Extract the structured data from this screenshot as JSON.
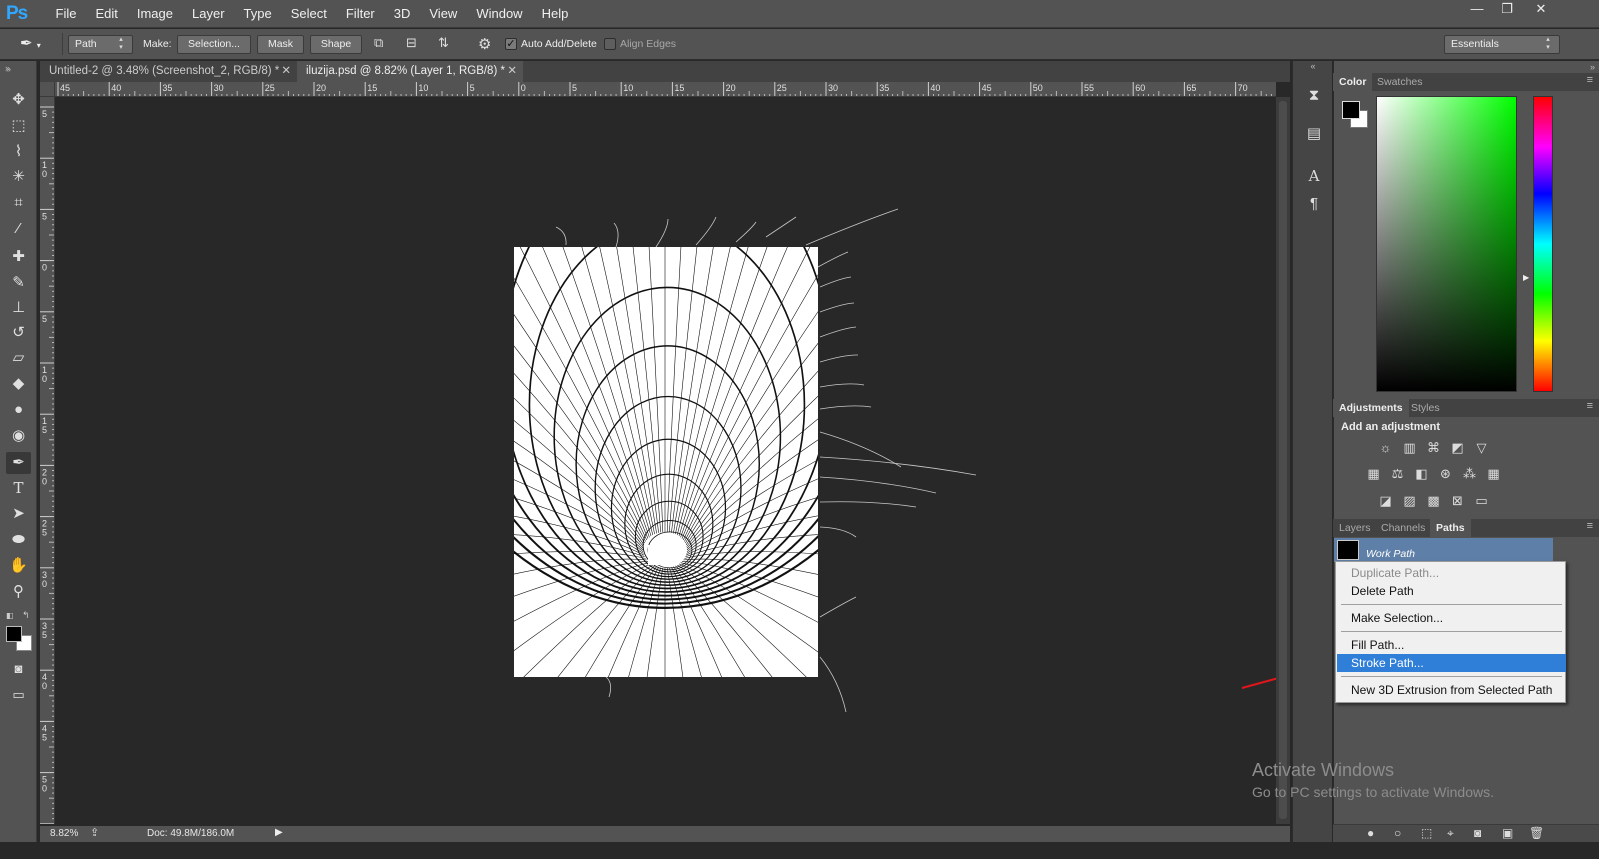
{
  "app": {
    "logo": "Ps"
  },
  "menu": [
    "File",
    "Edit",
    "Image",
    "Layer",
    "Type",
    "Select",
    "Filter",
    "3D",
    "View",
    "Window",
    "Help"
  ],
  "window_controls": {
    "minimize": "—",
    "restore": "❐",
    "close": "✕"
  },
  "options": {
    "mode": "Path",
    "make_label": "Make:",
    "selection_button": "Selection...",
    "mask_button": "Mask",
    "shape_button": "Shape",
    "auto_add_delete": "Auto Add/Delete",
    "auto_add_delete_checked": true,
    "align_edges": "Align Edges",
    "align_edges_checked": false,
    "workspace": "Essentials"
  },
  "tabs": [
    {
      "title": "Untitled-2 @ 3.48% (Screenshot_2, RGB/8) *",
      "active": false
    },
    {
      "title": "iluzija.psd @ 8.82% (Layer 1, RGB/8) *",
      "active": true
    }
  ],
  "ruler_top": [
    "45",
    "40",
    "35",
    "30",
    "25",
    "20",
    "15",
    "10",
    "5",
    "0",
    "5",
    "10",
    "15",
    "20",
    "25",
    "30",
    "35",
    "40",
    "45",
    "50",
    "55",
    "60",
    "65",
    "70"
  ],
  "ruler_left": [
    "5",
    "1 0",
    "5",
    "0",
    "5",
    "1 0",
    "1 5",
    "2 0",
    "2 5",
    "3 0",
    "3 5",
    "4 0",
    "4 5",
    "5 0",
    "5"
  ],
  "status": {
    "zoom": "8.82%",
    "doc": "Doc: 49.8M/186.0M"
  },
  "tools": [
    "move-icon",
    "marquee-icon",
    "lasso-icon",
    "magic-wand-icon",
    "crop-icon",
    "eyedropper-icon",
    "healing-brush-icon",
    "brush-icon",
    "clone-stamp-icon",
    "history-brush-icon",
    "eraser-icon",
    "paint-bucket-icon",
    "blur-icon",
    "dodge-icon",
    "pen-icon",
    "type-icon",
    "path-selection-icon",
    "ellipse-icon",
    "hand-icon",
    "zoom-icon"
  ],
  "color_panel": {
    "tabs": [
      "Color",
      "Swatches"
    ],
    "foreground": "#000000",
    "background": "#ffffff",
    "hue": "#00ff00"
  },
  "adjustments_panel": {
    "tabs": [
      "Adjustments",
      "Styles"
    ],
    "title": "Add an adjustment"
  },
  "layers_panel": {
    "tabs": [
      "Layers",
      "Channels",
      "Paths"
    ],
    "active_tab": "Paths",
    "path_name": "Work Path"
  },
  "context_menu": {
    "items": [
      {
        "label": "Duplicate Path...",
        "disabled": true
      },
      {
        "label": "Delete Path"
      },
      {
        "label": "Make Selection..."
      },
      {
        "label": "Fill Path..."
      },
      {
        "label": "Stroke Path...",
        "highlighted": true
      },
      {
        "label": "New 3D Extrusion from Selected Path"
      }
    ]
  },
  "watermark": {
    "title": "Activate Windows",
    "subtitle": "Go to PC settings to activate Windows."
  },
  "accent": {
    "highlight": "#2f7ed8",
    "arrow": "#e0161b"
  }
}
